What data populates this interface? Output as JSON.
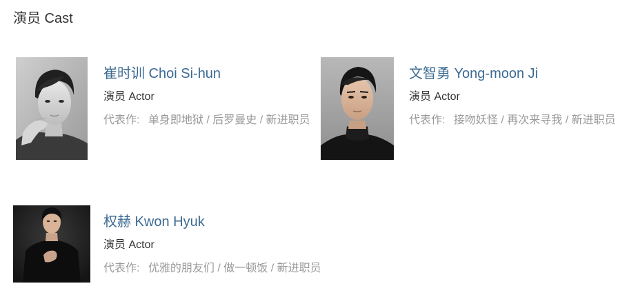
{
  "section": {
    "title": "演员 Cast"
  },
  "cast": [
    {
      "name": "崔时训 Choi Si-hun",
      "role": "演员 Actor",
      "works_label": "代表作:",
      "works": [
        "单身即地狱",
        "后罗曼史",
        "新进职员"
      ],
      "separator": " / ",
      "photo_style": "black-and-white portrait, hand on chin"
    },
    {
      "name": "文智勇 Yong-moon Ji",
      "role": "演员 Actor",
      "works_label": "代表作:",
      "works": [
        "接吻妖怪",
        "再次来寻我",
        "新进职员"
      ],
      "separator": " / ",
      "photo_style": "color portrait, black turtleneck, grey background"
    },
    {
      "name": "权赫 Kwon Hyuk",
      "role": "演员 Actor",
      "works_label": "代表作:",
      "works": [
        "优雅的朋友们",
        "做一顿饭",
        "新进职员"
      ],
      "separator": " / ",
      "photo_style": "color portrait, black outfit, dark background"
    }
  ],
  "colors": {
    "name_link": "#3c6a92",
    "role_text": "#333333",
    "works_text": "#999999",
    "title_text": "#333333"
  }
}
